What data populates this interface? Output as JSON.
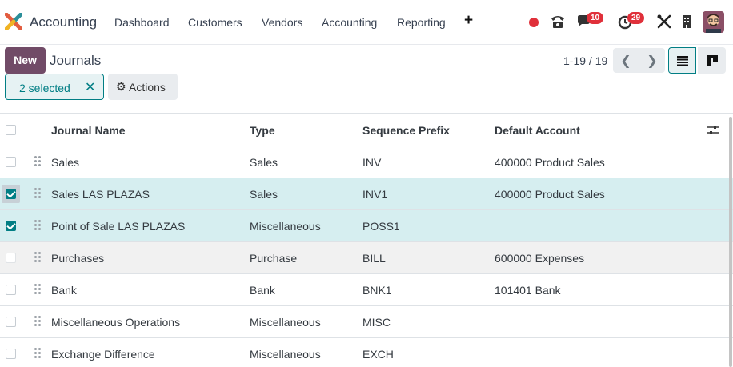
{
  "app": {
    "name": "Accounting",
    "menu": [
      "Dashboard",
      "Customers",
      "Vendors",
      "Accounting",
      "Reporting"
    ],
    "plus": "+",
    "badges": {
      "messages": "10",
      "activities": "29"
    }
  },
  "control": {
    "new_label": "New",
    "title": "Journals",
    "pager": "1-19 / 19",
    "selected_label": "2 selected",
    "actions_label": "Actions"
  },
  "table": {
    "headers": [
      "Journal Name",
      "Type",
      "Sequence Prefix",
      "Default Account"
    ],
    "rows": [
      {
        "name": "Sales",
        "type": "Sales",
        "prefix": "INV",
        "account": "400000 Product Sales",
        "selected": false
      },
      {
        "name": "Sales LAS PLAZAS",
        "type": "Sales",
        "prefix": "INV1",
        "account": "400000 Product Sales",
        "selected": true
      },
      {
        "name": "Point of Sale LAS PLAZAS",
        "type": "Miscellaneous",
        "prefix": "POSS1",
        "account": "",
        "selected": true
      },
      {
        "name": "Purchases",
        "type": "Purchase",
        "prefix": "BILL",
        "account": "600000 Expenses",
        "selected": false
      },
      {
        "name": "Bank",
        "type": "Bank",
        "prefix": "BNK1",
        "account": "101401 Bank",
        "selected": false
      },
      {
        "name": "Miscellaneous Operations",
        "type": "Miscellaneous",
        "prefix": "MISC",
        "account": "",
        "selected": false
      },
      {
        "name": "Exchange Difference",
        "type": "Miscellaneous",
        "prefix": "EXCH",
        "account": "",
        "selected": false
      }
    ]
  },
  "colors": {
    "brand": "#714b67",
    "accent": "#017e84",
    "selected_row": "#d6eef0"
  }
}
